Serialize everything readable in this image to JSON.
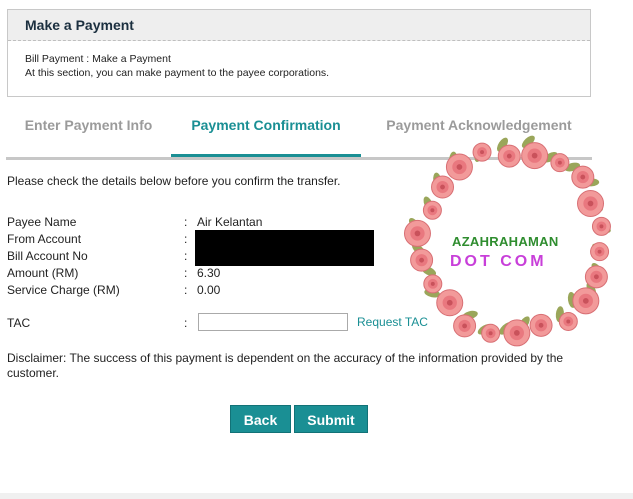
{
  "header": {
    "title": "Make a Payment",
    "breadcrumb": "Bill Payment : Make a Payment",
    "description": "At this section, you can make payment to the payee corporations."
  },
  "tabs": [
    {
      "label": "Enter Payment Info",
      "active": false
    },
    {
      "label": "Payment Confirmation",
      "active": true
    },
    {
      "label": "Payment Acknowledgement",
      "active": false
    }
  ],
  "intro": "Please check the details below before you confirm the transfer.",
  "fields": {
    "payee_name": {
      "label": "Payee Name",
      "value": "Air Kelantan"
    },
    "from_account": {
      "label": "From Account",
      "value": ""
    },
    "bill_account_no": {
      "label": "Bill Account No",
      "value": ""
    },
    "amount": {
      "label": "Amount (RM)",
      "value": "6.30"
    },
    "service_charge": {
      "label": "Service Charge (RM)",
      "value": "0.00"
    },
    "colon": ":"
  },
  "tac": {
    "label": "TAC",
    "value": "",
    "request_label": "Request TAC"
  },
  "disclaimer": "Disclaimer: The success of this payment is dependent on the accuracy of the information provided by the customer.",
  "buttons": {
    "back": "Back",
    "submit": "Submit"
  },
  "watermark": {
    "line1": "AZAHRAHAMAN",
    "line2": "DOT COM"
  },
  "colors": {
    "accent": "#1a8f94",
    "tab_inactive": "#9b9b9b",
    "watermark_green": "#2f8d2f",
    "watermark_purple": "#c83fd9"
  }
}
